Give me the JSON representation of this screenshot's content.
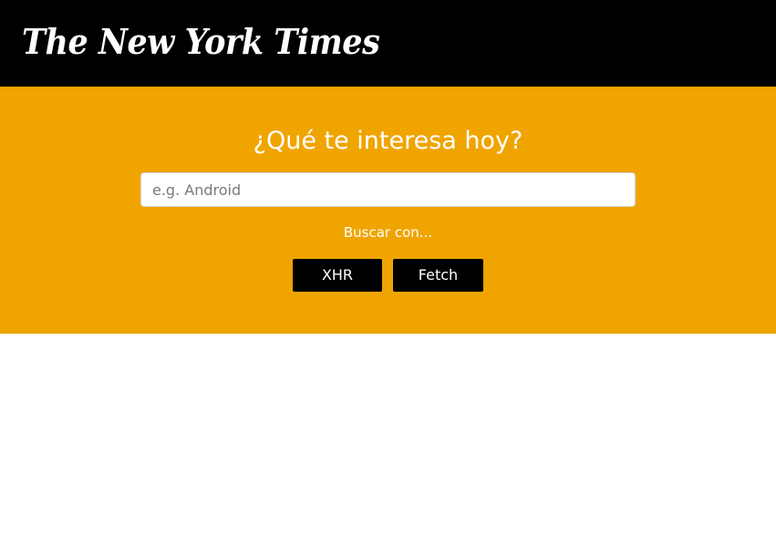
{
  "header": {
    "logo_text": "The New York Times"
  },
  "hero": {
    "title": "¿Qué te interesa hoy?",
    "search": {
      "placeholder": "e.g. Android",
      "value": ""
    },
    "search_with_label": "Buscar con...",
    "buttons": {
      "xhr_label": "XHR",
      "fetch_label": "Fetch"
    }
  },
  "colors": {
    "header_bg": "#000000",
    "hero_bg": "#f0a400",
    "button_bg": "#000000",
    "text_light": "#ffffff"
  }
}
